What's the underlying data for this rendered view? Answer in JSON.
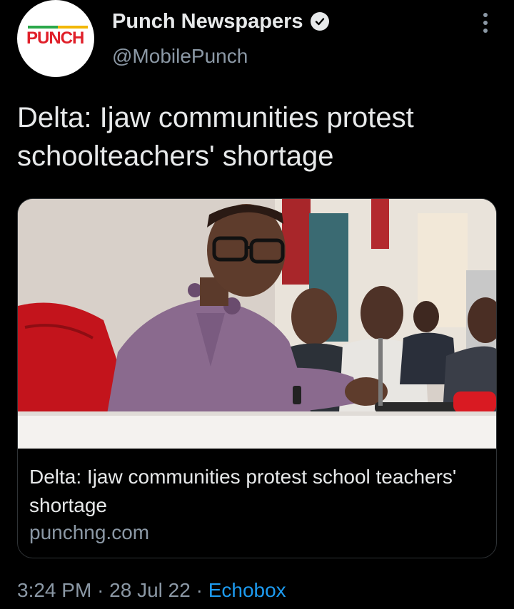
{
  "account": {
    "display_name": "Punch Newspapers",
    "handle": "@MobilePunch",
    "logo_text": "PUNCH",
    "verified": true
  },
  "tweet": {
    "text": "Delta: Ijaw communities protest schoolteachers' shortage"
  },
  "card": {
    "title": "Delta: Ijaw communities protest school teachers' shortage",
    "domain": "punchng.com"
  },
  "meta": {
    "time": "3:24 PM",
    "separator": "·",
    "date": "28 Jul 22",
    "source": "Echobox"
  },
  "icons": {
    "more": "more-vertical-icon",
    "verified": "verified-badge-icon"
  },
  "colors": {
    "background": "#000000",
    "text_primary": "#e7e9ea",
    "text_secondary": "#8b98a5",
    "link": "#1d9bf0",
    "card_border": "#2f3336",
    "brand_red": "#e0202a"
  }
}
